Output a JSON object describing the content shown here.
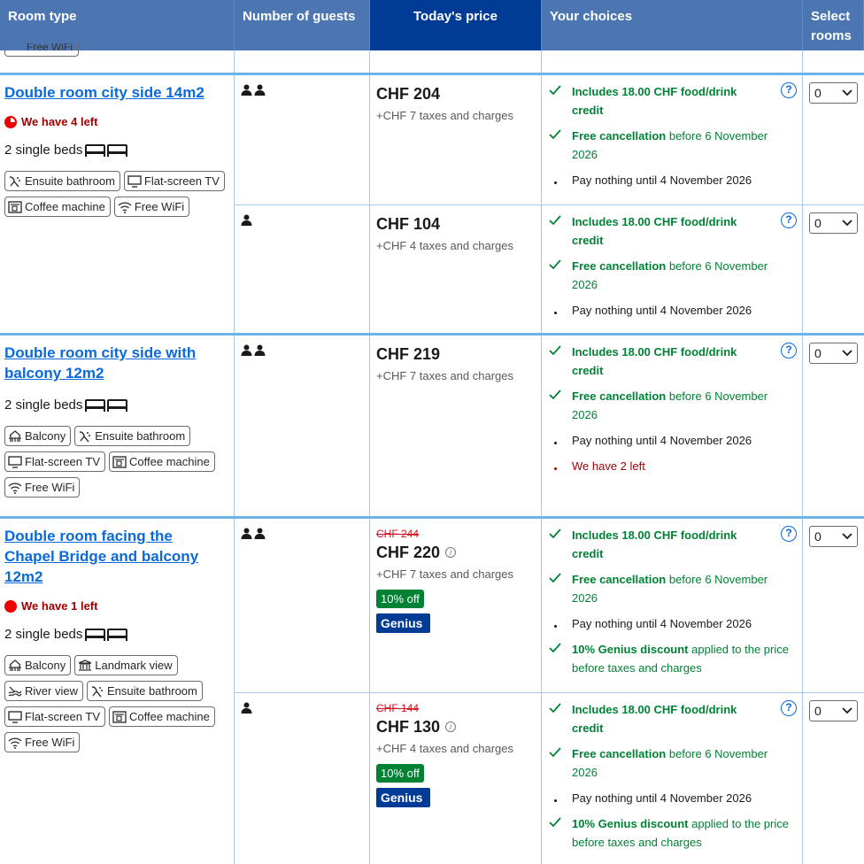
{
  "header": {
    "room_type": "Room type",
    "guests": "Number of guests",
    "price": "Today's price",
    "choices": "Your choices",
    "select": "Select rooms"
  },
  "sliver": {
    "chip_text": "Free WiFi"
  },
  "rooms": [
    {
      "name": "Double room city side 14m2",
      "left_warning": "We have 4 left",
      "beds": "2 single beds",
      "facilities": [
        "Ensuite bathroom",
        "Flat-screen TV",
        "Coffee machine",
        "Free WiFi"
      ],
      "rows": [
        {
          "price": "CHF 204",
          "taxes": "+CHF 7 taxes and charges",
          "credit": "Includes 18.00 CHF food/drink credit",
          "cancel_bold": "Free cancellation",
          "cancel_rest": "before 6 November 2026",
          "pay": "Pay nothing until 4 November 2026",
          "select_value": "0"
        },
        {
          "price": "CHF 104",
          "taxes": "+CHF 4 taxes and charges",
          "credit": "Includes 18.00 CHF food/drink credit",
          "cancel_bold": "Free cancellation",
          "cancel_rest": "before 6 November 2026",
          "pay": "Pay nothing until 4 November 2026",
          "select_value": "0"
        }
      ]
    },
    {
      "name": "Double room city side with balcony 12m2",
      "beds": "2 single beds",
      "facilities": [
        "Balcony",
        "Ensuite bathroom",
        "Flat-screen TV",
        "Coffee machine",
        "Free WiFi"
      ],
      "rows": [
        {
          "price": "CHF 219",
          "taxes": "+CHF 7 taxes and charges",
          "credit": "Includes 18.00 CHF food/drink credit",
          "cancel_bold": "Free cancellation",
          "cancel_rest": "before 6 November 2026",
          "pay": "Pay nothing until 4 November 2026",
          "left": "We have 2 left",
          "select_value": "0"
        }
      ]
    },
    {
      "name": "Double room facing the Chapel Bridge and balcony 12m2",
      "left_warning": "We have 1 left",
      "beds": "2 single beds",
      "facilities": [
        "Balcony",
        "Landmark view",
        "River view",
        "Ensuite bathroom",
        "Flat-screen TV",
        "Coffee machine",
        "Free WiFi"
      ],
      "rows": [
        {
          "old_price": "CHF 244",
          "price": "CHF 220",
          "taxes": "+CHF 7 taxes and charges",
          "discount": "10% off",
          "genius": "Genius",
          "credit": "Includes 18.00 CHF food/drink credit",
          "cancel_bold": "Free cancellation",
          "cancel_rest": "before 6 November 2026",
          "pay": "Pay nothing until 4 November 2026",
          "genius_bold": "10% Genius discount",
          "genius_rest": "applied to the price before taxes and charges",
          "select_value": "0"
        },
        {
          "old_price": "CHF 144",
          "price": "CHF 130",
          "taxes": "+CHF 4 taxes and charges",
          "discount": "10% off",
          "genius": "Genius",
          "credit": "Includes 18.00 CHF food/drink credit",
          "cancel_bold": "Free cancellation",
          "cancel_rest": "before 6 November 2026",
          "pay": "Pay nothing until 4 November 2026",
          "genius_bold": "10% Genius discount",
          "genius_rest": "applied to the price before taxes and charges",
          "select_value": "0"
        }
      ]
    }
  ]
}
